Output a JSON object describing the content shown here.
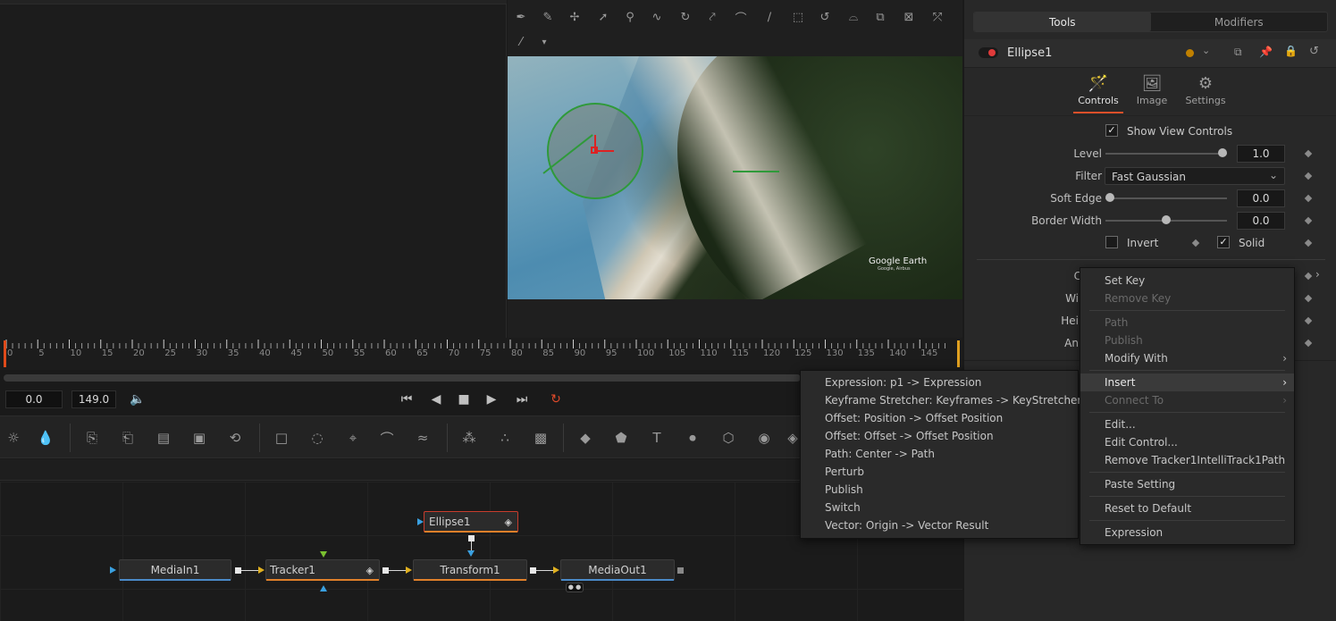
{
  "viewer": {
    "watermark_brand": "Google Earth",
    "watermark_credit": "Google, Airbus"
  },
  "timeline": {
    "tick_labels": [
      "0",
      "5",
      "10",
      "15",
      "20",
      "25",
      "30",
      "35",
      "40",
      "45",
      "50",
      "55",
      "60",
      "65",
      "70",
      "75",
      "80",
      "85",
      "90",
      "95",
      "100",
      "105",
      "110",
      "115",
      "120",
      "125",
      "130",
      "135",
      "140",
      "145"
    ],
    "current_time": "0.0",
    "end_time": "149.0"
  },
  "nodes": {
    "ellipse": "Ellipse1",
    "media_in": "MediaIn1",
    "tracker": "Tracker1",
    "transform": "Transform1",
    "media_out": "MediaOut1"
  },
  "inspector": {
    "tabs": {
      "tools": "Tools",
      "modifiers": "Modifiers"
    },
    "tool_name": "Ellipse1",
    "subtabs": {
      "controls": "Controls",
      "image": "Image",
      "settings": "Settings"
    },
    "show_view_controls": "Show View Controls",
    "params": {
      "level_label": "Level",
      "level_value": "1.0",
      "filter_label": "Filter",
      "filter_value": "Fast Gaussian",
      "soft_edge_label": "Soft Edge",
      "soft_edge_value": "0.0",
      "border_width_label": "Border Width",
      "border_width_value": "0.0",
      "invert_label": "Invert",
      "solid_label": "Solid",
      "center_label": "Cen",
      "width_label": "Wi",
      "height_label": "Hei",
      "angle_label": "An"
    },
    "colors": {
      "accent": "#e0502a",
      "ellipse_dot": "#c08000"
    }
  },
  "context_menu": {
    "items": {
      "set_key": "Set Key",
      "remove_key": "Remove Key",
      "path": "Path",
      "publish": "Publish",
      "modify_with": "Modify With",
      "insert": "Insert",
      "connect_to": "Connect To",
      "edit": "Edit...",
      "edit_control": "Edit Control...",
      "remove_tracker": "Remove Tracker1IntelliTrack1Path",
      "paste_setting": "Paste Setting",
      "reset_default": "Reset to Default",
      "expression": "Expression"
    }
  },
  "submenu": {
    "items": [
      "Expression: p1 -> Expression",
      "Keyframe Stretcher: Keyframes -> KeyStretcher",
      "Offset: Position -> Offset Position",
      "Offset: Offset -> Offset Position",
      "Path: Center -> Path",
      "Perturb",
      "Publish",
      "Switch",
      "Vector: Origin -> Vector Result"
    ]
  }
}
